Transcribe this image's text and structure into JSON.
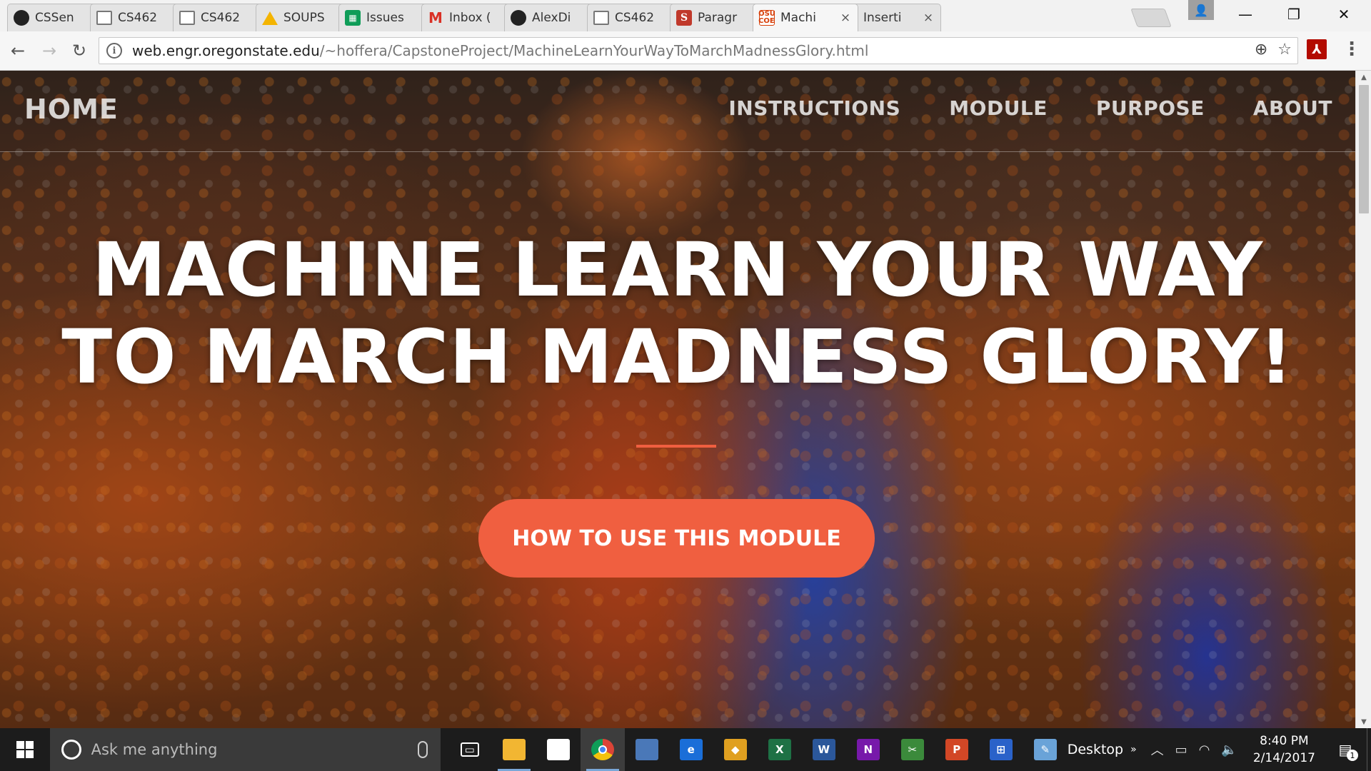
{
  "browser": {
    "tabs": [
      {
        "label": "CSSen",
        "favicon": "github-icon",
        "active": false
      },
      {
        "label": "CS462",
        "favicon": "document-icon",
        "active": false
      },
      {
        "label": "CS462",
        "favicon": "document-icon",
        "active": false
      },
      {
        "label": "SOUPS",
        "favicon": "google-drive-icon",
        "active": false
      },
      {
        "label": "Issues",
        "favicon": "google-sheets-icon",
        "active": false
      },
      {
        "label": "Inbox (",
        "favicon": "gmail-icon",
        "active": false
      },
      {
        "label": "AlexDi",
        "favicon": "github-icon",
        "active": false
      },
      {
        "label": "CS462",
        "favicon": "document-icon",
        "active": false
      },
      {
        "label": "Paragr",
        "favicon": "scribd-icon",
        "active": false
      },
      {
        "label": "Machi",
        "favicon": "osu-coe-icon",
        "active": true
      },
      {
        "label": "Inserti",
        "favicon": "scribd-icon",
        "active": false
      }
    ],
    "tab_close_glyph": "×",
    "osu_favicon_text": "OSU\nCOE",
    "url_host": "web.engr.oregonstate.edu",
    "url_path": "/~hoffera/CapstoneProject/MachineLearnYourWayToMarchMadnessGlory.html"
  },
  "page": {
    "brand": "HOME",
    "nav_links": [
      "INSTRUCTIONS",
      "MODULE",
      "PURPOSE",
      "ABOUT"
    ],
    "headline_line1": "MACHINE LEARN YOUR WAY",
    "headline_line2": "TO MARCH MADNESS GLORY!",
    "cta_label": "HOW TO USE THIS MODULE",
    "accent_color": "#f05f40"
  },
  "taskbar": {
    "search_placeholder": "Ask me anything",
    "apps": [
      {
        "name": "task-view-icon",
        "color": "#1c1c1c",
        "text": "▭",
        "open": false
      },
      {
        "name": "file-explorer-icon",
        "color": "#f2b632",
        "text": "",
        "open": true
      },
      {
        "name": "store-icon",
        "color": "#ffffff",
        "text": "",
        "open": false
      },
      {
        "name": "chrome-icon",
        "color": "#db4437",
        "text": "",
        "open": true,
        "active": true
      },
      {
        "name": "paint-net-icon",
        "color": "#4a78b8",
        "text": "",
        "open": false
      },
      {
        "name": "edge-icon",
        "color": "#1a6ed8",
        "text": "e",
        "open": false
      },
      {
        "name": "multicolor-app-icon",
        "color": "#e0a020",
        "text": "◆",
        "open": false
      },
      {
        "name": "excel-icon",
        "color": "#1e7145",
        "text": "X",
        "open": false
      },
      {
        "name": "word-icon",
        "color": "#2b579a",
        "text": "W",
        "open": false
      },
      {
        "name": "onenote-icon",
        "color": "#7719aa",
        "text": "N",
        "open": false
      },
      {
        "name": "snipping-tool-icon",
        "color": "#3b8a3b",
        "text": "✂",
        "open": false
      },
      {
        "name": "powerpoint-icon",
        "color": "#d24726",
        "text": "P",
        "open": false
      },
      {
        "name": "network-app-icon",
        "color": "#2a62c9",
        "text": "⊞",
        "open": false
      },
      {
        "name": "paint-icon",
        "color": "#6aa3d8",
        "text": "✎",
        "open": false
      }
    ],
    "desktop_label": "Desktop",
    "time": "8:40 PM",
    "date": "2/14/2017",
    "notification_count": "1"
  }
}
